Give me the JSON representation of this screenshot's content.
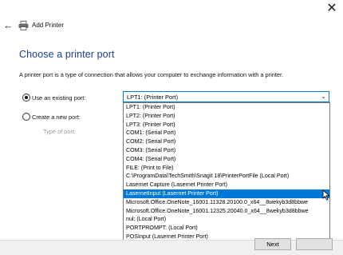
{
  "window": {
    "title": "Add Printer",
    "close_glyph": "✕",
    "back_glyph": "←"
  },
  "page": {
    "heading": "Choose a printer port",
    "description": "A printer port is a type of connection that allows your computer to exchange information with a printer."
  },
  "options": {
    "existing_label": "Use an existing port:",
    "existing_checked": true,
    "new_label": "Create a new port:",
    "new_checked": false,
    "type_of_port_label": "Type of port:"
  },
  "port_select": {
    "value": "LPT1: (Printer Port)",
    "caret_glyph": "⌄",
    "items": [
      "LPT1: (Printer Port)",
      "LPT2: (Printer Port)",
      "LPT3: (Printer Port)",
      "COM1: (Serial Port)",
      "COM2: (Serial Port)",
      "COM3: (Serial Port)",
      "COM4: (Serial Port)",
      "FILE: (Print to File)",
      "C:\\ProgramData\\TechSmith\\Snagit 18\\PrinterPortFile (Local Port)",
      "Lasernet Capture (Lasernet Printer Port)",
      "LasernetInput (Lasernet Printer Port)",
      "Microsoft.Office.OneNote_16001.11328.20100.0_x64__8wekyb3d8bbwe",
      "Microsoft.Office.OneNote_16001.12325.20040.0_x64__8wekyb3d8bbwe",
      "nul: (Local Port)",
      "PORTPROMPT: (Local Port)",
      "POSInput (Lasernet Printer Port)"
    ],
    "selected_index": 10
  },
  "footer": {
    "next_label": "Next"
  },
  "colors": {
    "heading": "#1a3f8a",
    "accent": "#0078d7"
  },
  "icons": [
    "close-icon",
    "back-arrow-icon",
    "printer-icon",
    "chevron-down-icon",
    "mouse-cursor-icon"
  ]
}
